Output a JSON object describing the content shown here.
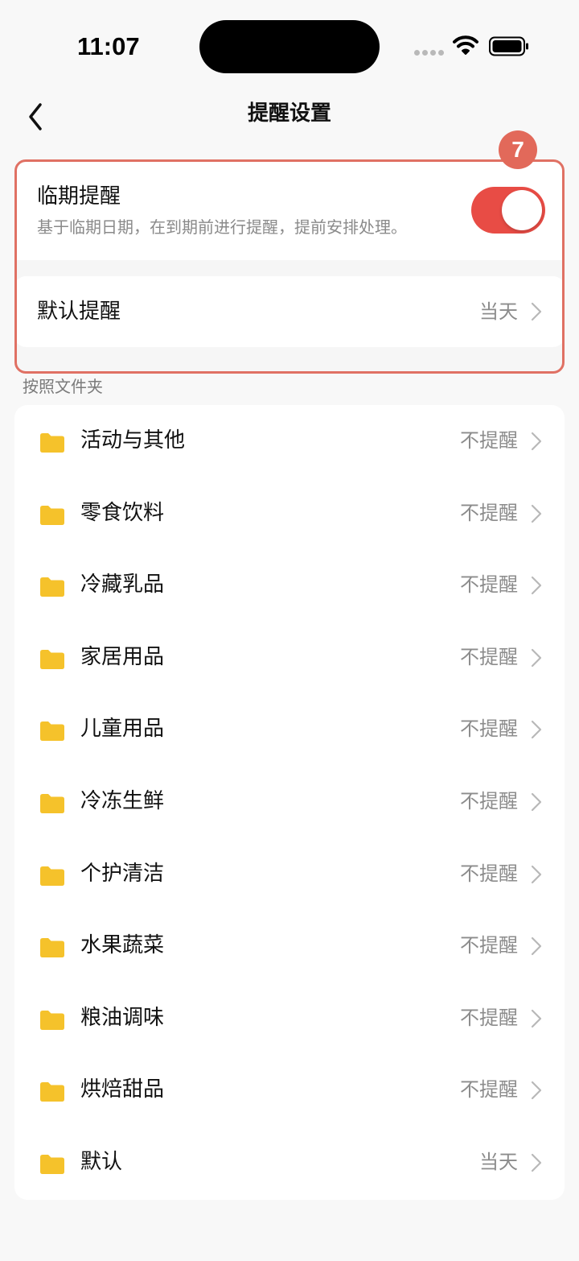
{
  "status_bar": {
    "time": "11:07",
    "icons": [
      "signal-dots-icon",
      "wifi-icon",
      "battery-icon"
    ]
  },
  "nav": {
    "back_icon": "chevron-left-icon",
    "title": "提醒设置"
  },
  "step_badge": "7",
  "colors": {
    "accent_toggle": "#e84c45",
    "highlight_border": "#e07164",
    "badge": "#e2695a",
    "folder": "#f5c22b",
    "secondary_text": "#8a8a8a",
    "background": "#f8f8f8"
  },
  "expiry_reminder": {
    "title": "临期提醒",
    "description": "基于临期日期，在到期前进行提醒，提前安排处理。",
    "enabled": true
  },
  "default_reminder": {
    "label": "默认提醒",
    "value": "当天"
  },
  "folders_section": {
    "label": "按照文件夹",
    "items": [
      {
        "name": "活动与其他",
        "value": "不提醒"
      },
      {
        "name": "零食饮料",
        "value": "不提醒"
      },
      {
        "name": "冷藏乳品",
        "value": "不提醒"
      },
      {
        "name": "家居用品",
        "value": "不提醒"
      },
      {
        "name": "儿童用品",
        "value": "不提醒"
      },
      {
        "name": "冷冻生鲜",
        "value": "不提醒"
      },
      {
        "name": "个护清洁",
        "value": "不提醒"
      },
      {
        "name": "水果蔬菜",
        "value": "不提醒"
      },
      {
        "name": "粮油调味",
        "value": "不提醒"
      },
      {
        "name": "烘焙甜品",
        "value": "不提醒"
      },
      {
        "name": "默认",
        "value": "当天"
      }
    ]
  }
}
